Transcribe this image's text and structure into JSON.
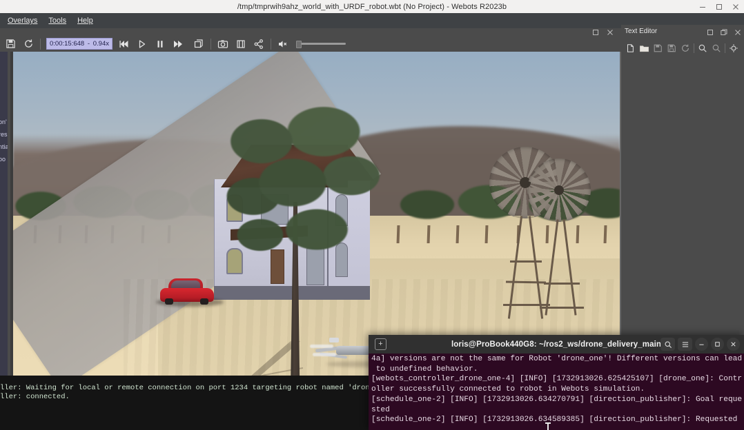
{
  "window": {
    "title": "/tmp/tmprwih9ahz_world_with_URDF_robot.wbt (No Project) - Webots R2023b",
    "controls": {
      "minimize": "minimize-window",
      "maximize": "maximize-window",
      "close": "close-window"
    }
  },
  "menubar": {
    "items": [
      {
        "label": "Overlays",
        "accel": "O"
      },
      {
        "label": "Tools",
        "accel": "T"
      },
      {
        "label": "Help",
        "accel": "H"
      }
    ]
  },
  "toolbar": {
    "save_label": "save-world",
    "reload_label": "reload-world",
    "time": "0:00:15:648",
    "time_separator": "-",
    "speed": "0.94x",
    "buttons": [
      {
        "name": "reset-simulation",
        "icon": "rewind-icon"
      },
      {
        "name": "step-simulation",
        "icon": "step-icon"
      },
      {
        "name": "pause-simulation",
        "icon": "pause-icon"
      },
      {
        "name": "run-fast-simulation",
        "icon": "fast-forward-icon"
      },
      {
        "name": "render-toggle",
        "icon": "cube-icon"
      },
      {
        "name": "take-screenshot",
        "icon": "camera-icon"
      },
      {
        "name": "make-movie",
        "icon": "movie-icon"
      },
      {
        "name": "share-simulation",
        "icon": "share-icon"
      },
      {
        "name": "sound-mute",
        "icon": "speaker-mute-icon"
      }
    ],
    "volume_value": 0
  },
  "viewport": {
    "name": "3d-simulation-view",
    "caption_buttons": [
      "maximize-view",
      "close-view"
    ],
    "scene": {
      "sky_color": "#a3b4c3",
      "ground_color": "#e8d8b2",
      "hill_color": "#6e6058",
      "tree_color": "#3e5135",
      "car_color": "#c8252d",
      "house_wall_color": "#c8c8d8",
      "house_roof_color": "#543a2b",
      "drone_color": "#c9ccd1",
      "path_color": "#a6a29e",
      "objects": [
        "house",
        "red-car",
        "pine-tree",
        "windmill",
        "windmill",
        "drone",
        "tree-line"
      ]
    }
  },
  "editor": {
    "title": "Text Editor",
    "header_buttons": [
      "dock-panel",
      "float-panel",
      "close-panel"
    ],
    "toolbar_buttons": [
      {
        "name": "new-file-button",
        "icon": "new-file-icon"
      },
      {
        "name": "open-file-button",
        "icon": "open-folder-icon"
      },
      {
        "name": "save-file-button",
        "icon": "save-icon"
      },
      {
        "name": "save-as-button",
        "icon": "save-as-icon"
      },
      {
        "name": "revert-file-button",
        "icon": "reload-icon"
      },
      {
        "name": "find-button",
        "icon": "search-icon"
      },
      {
        "name": "find-next-button",
        "icon": "search-next-icon"
      },
      {
        "name": "replace-button",
        "icon": "gear-icon"
      }
    ]
  },
  "side_stub": {
    "name": "scene-tree-panel-stub",
    "lines": [
      "on'",
      "res",
      "ntia",
      "oo"
    ]
  },
  "webots_console": {
    "name": "webots-console",
    "lines": [
      "ller: Waiting for local or remote connection on port 1234 targeting robot named 'drone_one'.",
      "ller: connected."
    ]
  },
  "terminal": {
    "title": "loris@ProBook440G8: ~/ros2_ws/drone_delivery_main",
    "buttons": [
      {
        "name": "new-tab-button",
        "icon": "plus-box-icon"
      },
      {
        "name": "terminal-search-button",
        "icon": "search-icon"
      },
      {
        "name": "terminal-menu-button",
        "icon": "hamburger-icon"
      },
      {
        "name": "terminal-minimize-button",
        "icon": "minimize-icon"
      },
      {
        "name": "terminal-maximize-button",
        "icon": "maximize-icon"
      },
      {
        "name": "terminal-close-button",
        "icon": "close-icon"
      }
    ],
    "lines": [
      "4a] versions are not the same for Robot 'drone_one'! Different versions can lead",
      " to undefined behavior.",
      "[webots_controller_drone_one-4] [INFO] [1732913026.625425107] [drone_one]: Contr",
      "oller successfully connected to robot in Webots simulation.",
      "[schedule_one-2] [INFO] [1732913026.634270791] [direction_publisher]: Goal reque",
      "sted",
      "[schedule_one-2] [INFO] [1732913026.634589385] [direction_publisher]: Requested"
    ]
  }
}
